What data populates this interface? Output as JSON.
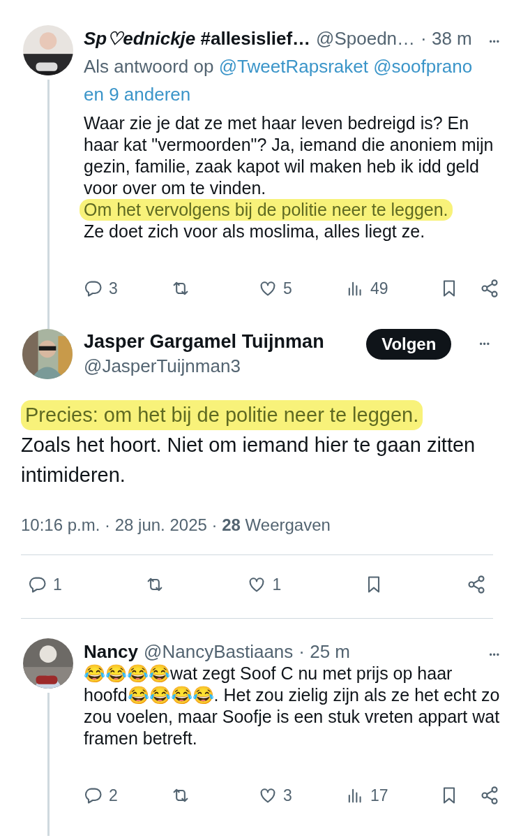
{
  "tweets": [
    {
      "kind": "reply",
      "author": {
        "name": "*Sp♡ednickje* #allesislief…",
        "handle": "@Spoedn…",
        "time": "· 38 m"
      },
      "more": "•••",
      "reply_to": {
        "prefix": "Als antwoord op",
        "links": [
          "@TweetRapsraket",
          "@soofprano",
          "en 9 anderen"
        ]
      },
      "body": [
        {
          "text": "Waar zie je dat ze met haar leven bedreigd is? En haar kat \"vermoorden\"? Ja, iemand die anoniem mijn gezin, familie, zaak kapot wil maken heb ik idd geld voor over om te vinden.",
          "highlighted": false
        },
        {
          "text": "Om het vervolgens bij de politie neer te leggen.",
          "highlighted": true
        },
        {
          "text": "Ze doet zich voor als moslima, alles liegt ze.",
          "highlighted": false
        }
      ],
      "actions": [
        {
          "kind": "reply",
          "count": "3"
        },
        {
          "kind": "repost"
        },
        {
          "kind": "like",
          "count": "5"
        },
        {
          "kind": "views",
          "count": "49"
        },
        {
          "kind": "bookmark"
        },
        {
          "kind": "share"
        }
      ]
    },
    {
      "kind": "main",
      "author": {
        "name": "Jasper Gargamel Tuijnman",
        "handle": "@JasperTuijnman3"
      },
      "follow": "Volgen",
      "more": "•••",
      "body": [
        {
          "text": "Precies: om het bij de politie neer te leggen.",
          "highlighted": true
        },
        {
          "text": "Zoals het hoort. Niet om iemand hier te gaan zitten intimideren.",
          "highlighted": false
        }
      ],
      "meta": "10:16 p.m. · 28 jun. 2025 · **28** Weergaven",
      "actions": [
        {
          "kind": "reply",
          "count": "1"
        },
        {
          "kind": "repost"
        },
        {
          "kind": "like",
          "count": "1"
        },
        {
          "kind": "bookmark"
        },
        {
          "kind": "share"
        }
      ]
    },
    {
      "kind": "reply",
      "author": {
        "name": "Nancy",
        "handle": "@NancyBastiaans",
        "time": "· 25 m"
      },
      "more": "•••",
      "body": [
        {
          "text": "😂😂😂😂wat zegt Soof C nu met prijs op haar hoofd😂😂😂😂. Het zou zielig zijn als ze het echt zo zou voelen, maar Soofje is een stuk vreten appart wat framen betreft.",
          "highlighted": false
        }
      ],
      "actions": [
        {
          "kind": "reply",
          "count": "2"
        },
        {
          "kind": "repost"
        },
        {
          "kind": "like",
          "count": "3"
        },
        {
          "kind": "views",
          "count": "17"
        },
        {
          "kind": "bookmark"
        },
        {
          "kind": "share"
        }
      ]
    }
  ]
}
